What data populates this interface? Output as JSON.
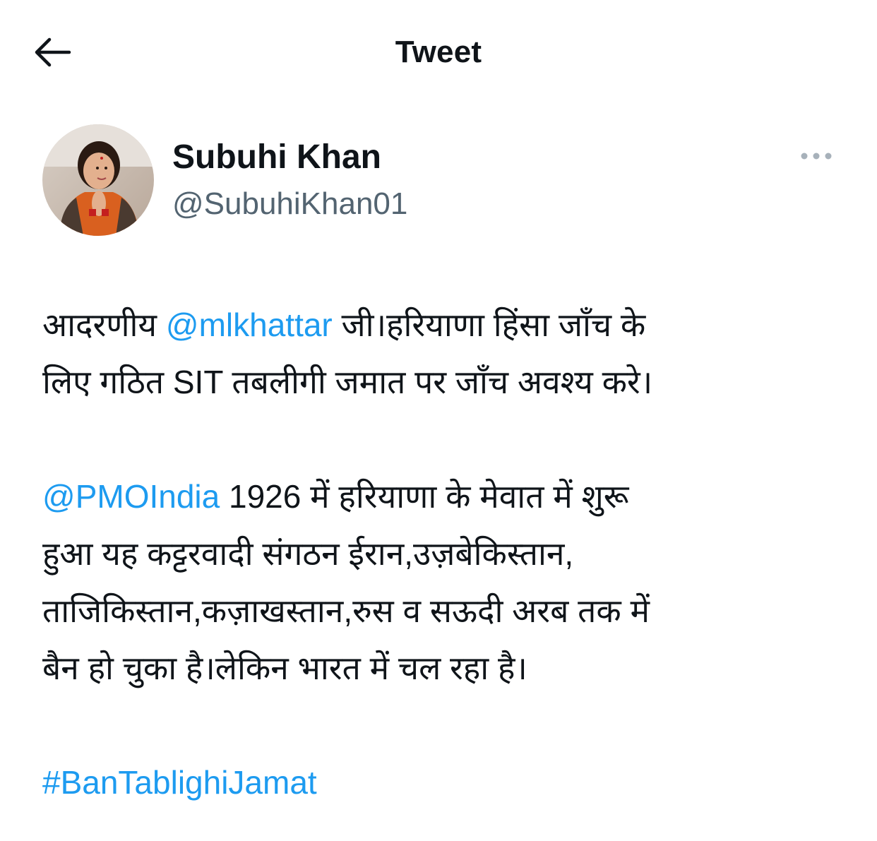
{
  "header": {
    "title": "Tweet",
    "back_icon": "arrow-left-icon"
  },
  "author": {
    "display_name": "Subuhi Khan",
    "handle": "@SubuhiKhan01",
    "more_icon": "more-horizontal-icon"
  },
  "colors": {
    "link": "#1d9bf0",
    "text": "#0f1419",
    "secondary": "#536471"
  },
  "tweet": {
    "p1_line1_a": "आदरणीय ",
    "p1_mention": "@mlkhattar",
    "p1_line1_b": " जी।हरियाणा हिंसा जाँच के",
    "p1_line2": "लिए गठित SIT तबलीगी जमात पर जाँच अवश्य करे।",
    "p2_mention": "@PMOIndia",
    "p2_line1_b": " 1926 में हरियाणा के मेवात में शुरू",
    "p2_line2": "हुआ यह कट्टरवादी संगठन ईरान,उज़बेकिस्तान,",
    "p2_line3": "ताजिकिस्तान,कज़ाखस्तान,रुस व सऊदी अरब तक में",
    "p2_line4": "बैन हो चुका है।लेकिन भारत में चल रहा है।",
    "hashtag": "#BanTablighiJamat"
  }
}
